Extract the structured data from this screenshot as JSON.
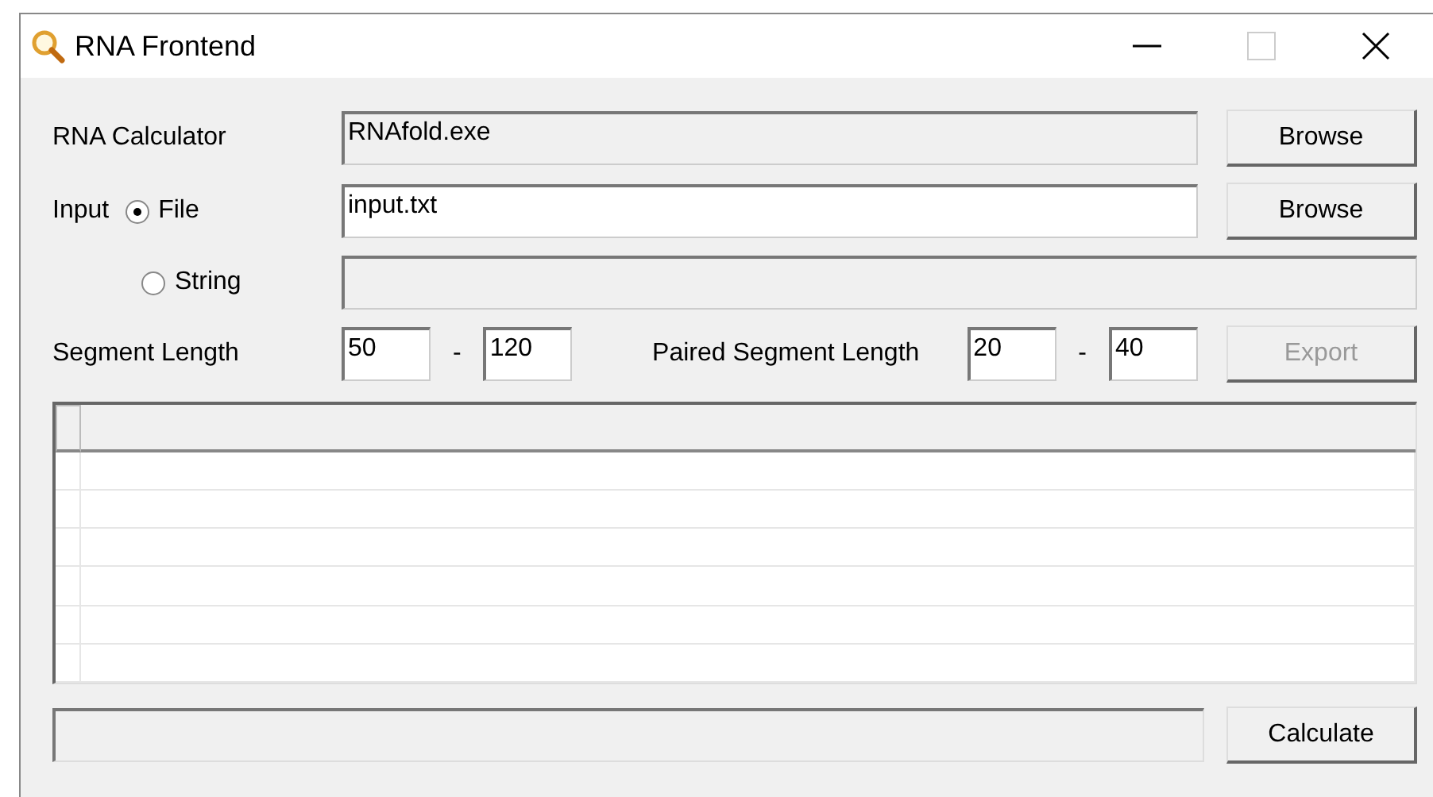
{
  "window": {
    "title": "RNA Frontend"
  },
  "calculator": {
    "label": "RNA Calculator",
    "value": "RNAfold.exe",
    "disabled": true,
    "button": "Browse"
  },
  "input": {
    "label": "Input",
    "options": [
      {
        "label": "File",
        "selected": true,
        "value": "input.txt",
        "disabled": false,
        "button": "Browse"
      },
      {
        "label": "String",
        "selected": false,
        "disabled": true
      }
    ]
  },
  "segment": {
    "label": "Segment Length",
    "from": "50",
    "to": "120",
    "separator": "-"
  },
  "paired": {
    "label": "Paired Segment Length",
    "from": "20",
    "to": "40",
    "separator": "-"
  },
  "export": {
    "label": "Export",
    "disabled": true
  },
  "calculate": {
    "label": "Calculate"
  }
}
